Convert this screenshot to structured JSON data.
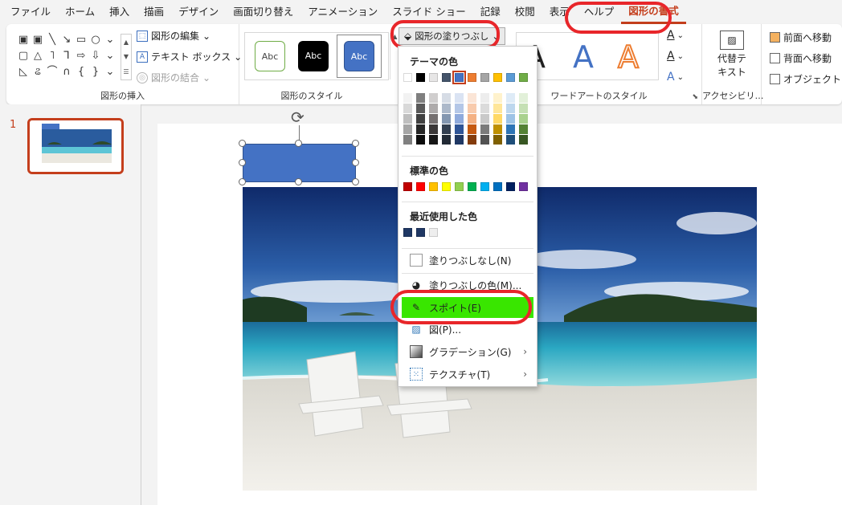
{
  "menu": {
    "tabs": [
      "ファイル",
      "ホーム",
      "挿入",
      "描画",
      "デザイン",
      "画面切り替え",
      "アニメーション",
      "スライド ショー",
      "記録",
      "校閲",
      "表示",
      "ヘルプ",
      "図形の書式"
    ],
    "active_tab": "図形の書式"
  },
  "ribbon": {
    "insert_shapes": {
      "label": "図形の挿入",
      "edit_shape": "図形の編集",
      "text_box": "テキスト ボックス",
      "merge_shapes": "図形の結合"
    },
    "shape_styles": {
      "label": "図形のスタイル",
      "presets": [
        "Abc",
        "Abc",
        "Abc"
      ],
      "fill_button": "図形の塗りつぶし"
    },
    "wordart": {
      "label": "ワードアートのスタイル",
      "samples": [
        "A",
        "A",
        "A"
      ]
    },
    "accessibility": {
      "label": "アクセシビリ…",
      "alt_text_line1": "代替テ",
      "alt_text_line2": "キスト"
    },
    "arrange": {
      "bring_forward": "前面へ移動",
      "send_backward": "背面へ移動",
      "selection_pane": "オブジェクトの選"
    }
  },
  "thumbnails": {
    "slide_number": "1"
  },
  "fill_menu": {
    "theme_colors_header": "テーマの色",
    "standard_colors_header": "標準の色",
    "recent_colors_header": "最近使用した色",
    "theme_top_row": [
      "#ffffff",
      "#000000",
      "#e7e6e6",
      "#44546a",
      "#4472c4",
      "#ed7d31",
      "#a5a5a5",
      "#ffc000",
      "#5b9bd5",
      "#70ad47"
    ],
    "theme_shades": [
      [
        "#f2f2f2",
        "#7f7f7f",
        "#d0cece",
        "#d6dce5",
        "#dae3f3",
        "#fbe5d6",
        "#ededed",
        "#fff2cc",
        "#deebf7",
        "#e2f0d9"
      ],
      [
        "#d9d9d9",
        "#595959",
        "#aeabab",
        "#adb9ca",
        "#b4c7e7",
        "#f8cbad",
        "#dbdbdb",
        "#ffe699",
        "#bdd7ee",
        "#c5e0b4"
      ],
      [
        "#bfbfbf",
        "#404040",
        "#767171",
        "#8497b0",
        "#8faadc",
        "#f4b183",
        "#c9c9c9",
        "#ffd966",
        "#9dc3e6",
        "#a9d18e"
      ],
      [
        "#a6a6a6",
        "#262626",
        "#3b3838",
        "#333f50",
        "#2f5597",
        "#c55a11",
        "#7b7b7b",
        "#bf9000",
        "#2e75b6",
        "#548235"
      ],
      [
        "#808080",
        "#0d0d0d",
        "#171717",
        "#222a35",
        "#203864",
        "#843c0c",
        "#525252",
        "#7f6000",
        "#1f4e79",
        "#385723"
      ]
    ],
    "standard_colors": [
      "#c00000",
      "#ff0000",
      "#ffc000",
      "#ffff00",
      "#92d050",
      "#00b050",
      "#00b0f0",
      "#0070c0",
      "#002060",
      "#7030a0"
    ],
    "recent_colors": [
      "#1f3864",
      "#203864",
      "#eeeeee"
    ],
    "items": [
      {
        "label": "塗りつぶしなし(N)",
        "icon": "no-fill-icon"
      },
      {
        "label": "塗りつぶしの色(M)...",
        "icon": "palette-icon"
      },
      {
        "label": "スポイト(E)",
        "icon": "eyedropper-icon"
      },
      {
        "label": "図(P)...",
        "icon": "picture-icon"
      },
      {
        "label": "グラデーション(G)",
        "icon": "gradient-icon"
      },
      {
        "label": "テクスチャ(T)",
        "icon": "texture-icon"
      }
    ]
  },
  "colors": {
    "accent": "#c43e1c",
    "callout": "#e8262a",
    "highlight": "#39e600",
    "selected_shape": "#4472c4"
  }
}
